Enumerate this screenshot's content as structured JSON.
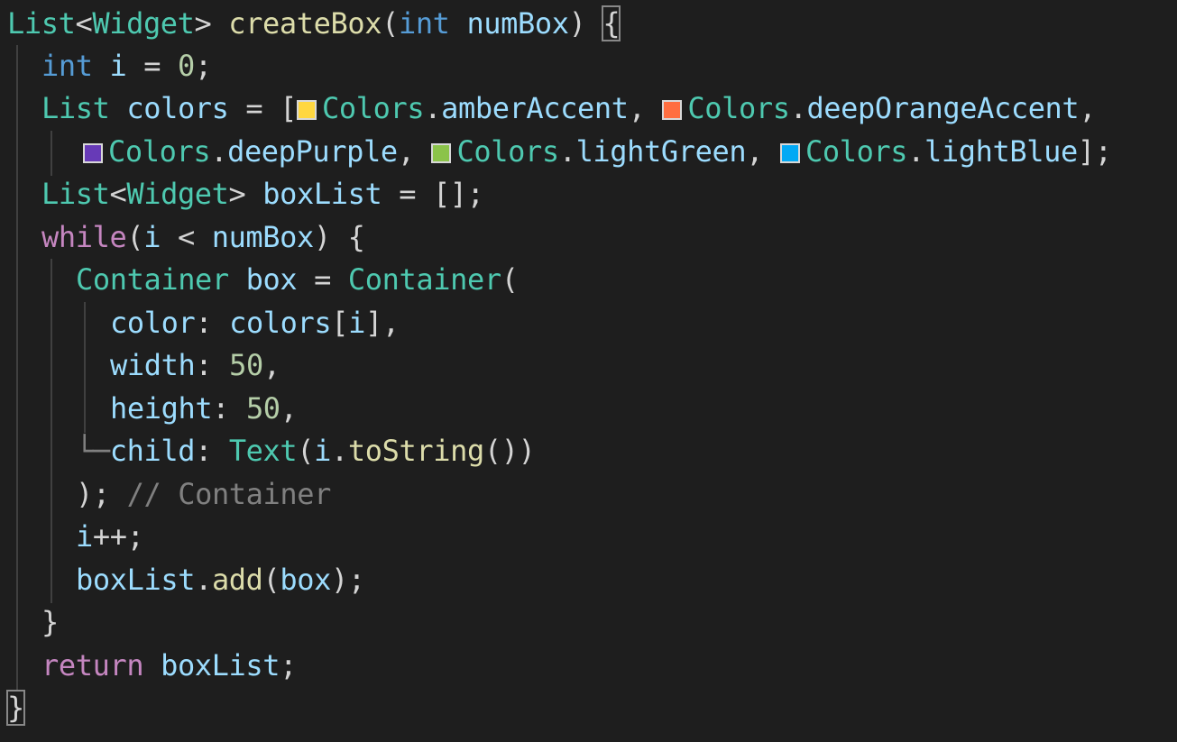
{
  "editor": {
    "background": "#1e1e1e",
    "lines": [
      {
        "t": [
          [
            "type",
            "List"
          ],
          [
            "punc",
            "<"
          ],
          [
            "type",
            "Widget"
          ],
          [
            "punc",
            "> "
          ],
          [
            "fn",
            "createBox"
          ],
          [
            "punc",
            "("
          ],
          [
            "kw",
            "int"
          ],
          [
            "punc",
            " "
          ],
          [
            "var",
            "numBox"
          ],
          [
            "punc",
            ") "
          ],
          [
            "bracketbox",
            "{"
          ]
        ]
      },
      {
        "t": [
          [
            "kw",
            "int"
          ],
          [
            "punc",
            " "
          ],
          [
            "var",
            "i"
          ],
          [
            "punc",
            " = "
          ],
          [
            "num",
            "0"
          ],
          [
            "punc",
            ";"
          ]
        ]
      },
      {
        "t": [
          [
            "type",
            "List"
          ],
          [
            "punc",
            " "
          ],
          [
            "var",
            "colors"
          ],
          [
            "punc",
            " = ["
          ],
          [
            "swatch",
            "#ffd740"
          ],
          [
            "type",
            "Colors"
          ],
          [
            "punc",
            "."
          ],
          [
            "var",
            "amberAccent"
          ],
          [
            "punc",
            ", "
          ],
          [
            "swatch",
            "#ff6e40"
          ],
          [
            "type",
            "Colors"
          ],
          [
            "punc",
            "."
          ],
          [
            "var",
            "deepOrangeAccent"
          ],
          [
            "punc",
            ","
          ]
        ]
      },
      {
        "t": [
          [
            "swatch",
            "#673ab7"
          ],
          [
            "type",
            "Colors"
          ],
          [
            "punc",
            "."
          ],
          [
            "var",
            "deepPurple"
          ],
          [
            "punc",
            ", "
          ],
          [
            "swatch",
            "#8bc34a"
          ],
          [
            "type",
            "Colors"
          ],
          [
            "punc",
            "."
          ],
          [
            "var",
            "lightGreen"
          ],
          [
            "punc",
            ", "
          ],
          [
            "swatch",
            "#03a9f4"
          ],
          [
            "type",
            "Colors"
          ],
          [
            "punc",
            "."
          ],
          [
            "var",
            "lightBlue"
          ],
          [
            "punc",
            "];"
          ]
        ]
      },
      {
        "t": [
          [
            "type",
            "List"
          ],
          [
            "punc",
            "<"
          ],
          [
            "type",
            "Widget"
          ],
          [
            "punc",
            "> "
          ],
          [
            "var",
            "boxList"
          ],
          [
            "punc",
            " = [];"
          ]
        ]
      },
      {
        "t": [
          [
            "ctrl",
            "while"
          ],
          [
            "punc",
            "("
          ],
          [
            "var",
            "i"
          ],
          [
            "punc",
            " < "
          ],
          [
            "var",
            "numBox"
          ],
          [
            "punc",
            ") {"
          ]
        ]
      },
      {
        "t": [
          [
            "type",
            "Container"
          ],
          [
            "punc",
            " "
          ],
          [
            "var",
            "box"
          ],
          [
            "punc",
            " = "
          ],
          [
            "type",
            "Container"
          ],
          [
            "punc",
            "("
          ]
        ]
      },
      {
        "t": [
          [
            "var",
            "color"
          ],
          [
            "punc",
            ": "
          ],
          [
            "var",
            "colors"
          ],
          [
            "punc",
            "["
          ],
          [
            "var",
            "i"
          ],
          [
            "punc",
            "],"
          ]
        ]
      },
      {
        "t": [
          [
            "var",
            "width"
          ],
          [
            "punc",
            ": "
          ],
          [
            "num",
            "50"
          ],
          [
            "punc",
            ","
          ]
        ]
      },
      {
        "t": [
          [
            "var",
            "height"
          ],
          [
            "punc",
            ": "
          ],
          [
            "num",
            "50"
          ],
          [
            "punc",
            ","
          ]
        ]
      },
      {
        "t": [
          [
            "tree",
            "└─"
          ],
          [
            "var",
            "child"
          ],
          [
            "punc",
            ": "
          ],
          [
            "type",
            "Text"
          ],
          [
            "punc",
            "("
          ],
          [
            "var",
            "i"
          ],
          [
            "punc",
            "."
          ],
          [
            "fn",
            "toString"
          ],
          [
            "punc",
            "())"
          ]
        ]
      },
      {
        "t": [
          [
            "punc",
            "); "
          ],
          [
            "gray",
            "// Container"
          ]
        ]
      },
      {
        "t": [
          [
            "var",
            "i"
          ],
          [
            "punc",
            "++;"
          ]
        ]
      },
      {
        "t": [
          [
            "var",
            "boxList"
          ],
          [
            "punc",
            "."
          ],
          [
            "fn",
            "add"
          ],
          [
            "punc",
            "("
          ],
          [
            "var",
            "box"
          ],
          [
            "punc",
            ");"
          ]
        ]
      },
      {
        "t": [
          [
            "punc",
            "}"
          ]
        ]
      },
      {
        "t": [
          [
            "ctrl",
            "return"
          ],
          [
            "punc",
            " "
          ],
          [
            "var",
            "boxList"
          ],
          [
            "punc",
            ";"
          ]
        ]
      },
      {
        "t": [
          [
            "bracketbox",
            "}"
          ]
        ]
      }
    ]
  }
}
